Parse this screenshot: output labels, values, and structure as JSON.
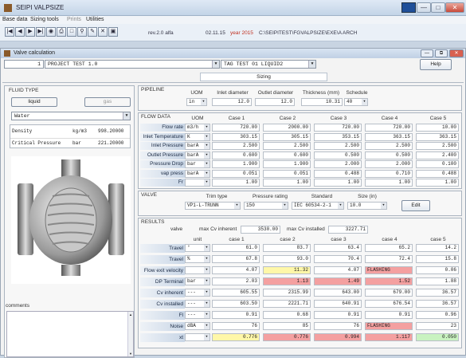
{
  "app": {
    "title": "SEIPI VALPSIZE"
  },
  "menu": [
    "Base data",
    "Sizing tools",
    "Prints",
    "Utilities"
  ],
  "toolbar": {
    "version": "rev.2.0 alfa",
    "time": "02.11.15",
    "year": "year 2015",
    "path": "C:\\SEIPITEST\\FGVALPSIZE\\EXE\\A  ARCH"
  },
  "window": {
    "title": "Valve calculation"
  },
  "header": {
    "project_no": "1",
    "project": "PROJECT TEST 1.0",
    "tag": "TAG TEST 01 LIQUID2",
    "help": "Help",
    "tab": "Sizing"
  },
  "fluid": {
    "section": "FLUID TYPE",
    "liquid": "liquid",
    "gas": "gas",
    "selected": "Water",
    "props": [
      {
        "name": "Density",
        "unit": "kg/m3",
        "value": "998.20000"
      },
      {
        "name": "Critical Pressure",
        "unit": "bar",
        "value": "221.20000"
      }
    ]
  },
  "comments_label": "comments",
  "pipeline": {
    "section": "PIPELINE",
    "headers": [
      "UOM",
      "Inlet diameter",
      "Outlet diameter",
      "Thickness (mm)",
      "Schedule"
    ],
    "uom": "in",
    "inlet": "12.0",
    "outlet": "12.0",
    "thickness": "10.31",
    "schedule": "40"
  },
  "flow": {
    "section": "FLOW DATA",
    "headers": [
      "UOM",
      "Case 1",
      "Case 2",
      "Case 3",
      "Case 4",
      "Case 5"
    ],
    "rows": [
      {
        "label": "Flow rate",
        "unit": "m3/h",
        "values": [
          "720.00",
          "2000.00",
          "720.00",
          "720.00",
          "10.00"
        ]
      },
      {
        "label": "Inlet Temperature",
        "unit": "K",
        "values": [
          "303.15",
          "305.15",
          "353.15",
          "363.15",
          "363.15"
        ]
      },
      {
        "label": "Inlet Pressure",
        "unit": "barA",
        "values": [
          "2.500",
          "2.500",
          "2.500",
          "2.500",
          "2.500"
        ]
      },
      {
        "label": "Outlet Pressure",
        "unit": "barA",
        "values": [
          "0.600",
          "0.600",
          "0.500",
          "0.500",
          "2.400"
        ]
      },
      {
        "label": "Pressure Drop",
        "unit": "bar",
        "values": [
          "1.900",
          "1.900",
          "2.000",
          "2.000",
          "0.100"
        ]
      },
      {
        "label": "vap press",
        "unit": "barA",
        "values": [
          "0.051",
          "0.051",
          "0.488",
          "0.710",
          "0.488"
        ]
      },
      {
        "label": "Fr",
        "unit": "",
        "values": [
          "1.00",
          "1.00",
          "1.00",
          "1.00",
          "1.00"
        ]
      }
    ]
  },
  "valve": {
    "section": "VALVE",
    "headers": [
      "Trim type",
      "Pressure rating",
      "Standard",
      "Size (in)"
    ],
    "trim": "VP1-L-TRUNN",
    "rating": "150",
    "standard": "IEC 60534-2-1",
    "size": "10.0",
    "edit": "Edit"
  },
  "results": {
    "section": "RESULTS",
    "valve_label": "valve",
    "cv_inherent_label": "max Cv inherent",
    "cv_inherent": "3530.00",
    "cv_installed_label": "max Cv installed",
    "cv_installed": "3227.71",
    "headers": [
      "unit",
      "case 1",
      "case 2",
      "case 3",
      "case 4",
      "case 5"
    ],
    "rows": [
      {
        "label": "Travel",
        "unit": "°",
        "values": [
          "61.0",
          "83.7",
          "63.4",
          "65.2",
          "14.2"
        ],
        "colors": [
          "",
          "",
          "",
          "",
          ""
        ]
      },
      {
        "label": "Travel",
        "unit": "%",
        "values": [
          "67.8",
          "93.0",
          "70.4",
          "72.4",
          "15.8"
        ],
        "colors": [
          "",
          "",
          "",
          "",
          ""
        ]
      },
      {
        "label": "Flow exit velocity",
        "unit": "",
        "values": [
          "4.07",
          "11.32",
          "4.07",
          "FLASHING",
          "0.06"
        ],
        "colors": [
          "",
          "#fff7a8",
          "",
          "#f4a0a0",
          ""
        ]
      },
      {
        "label": "DP Terminal",
        "unit": "bar",
        "values": [
          "2.03",
          "1.13",
          "1.49",
          "1.52",
          "1.88"
        ],
        "colors": [
          "",
          "#f4a0a0",
          "#f4a0a0",
          "#f4a0a0",
          ""
        ]
      },
      {
        "label": "Cv inherent",
        "unit": "---",
        "values": [
          "605.55",
          "2315.99",
          "643.00",
          "679.00",
          "36.57"
        ],
        "colors": [
          "",
          "",
          "",
          "",
          ""
        ]
      },
      {
        "label": "Cv installed",
        "unit": "---",
        "values": [
          "603.50",
          "2221.71",
          "640.91",
          "676.54",
          "36.57"
        ],
        "colors": [
          "",
          "",
          "",
          "",
          ""
        ]
      },
      {
        "label": "Fl",
        "unit": "---",
        "values": [
          "0.91",
          "0.68",
          "0.91",
          "0.91",
          "0.96"
        ],
        "colors": [
          "",
          "",
          "",
          "",
          ""
        ]
      },
      {
        "label": "Noise",
        "unit": "dBA",
        "values": [
          "76",
          "85",
          "76",
          "FLASHING",
          "23"
        ],
        "colors": [
          "",
          "",
          "",
          "#f4a0a0",
          ""
        ]
      },
      {
        "label": "xt",
        "unit": "",
        "values": [
          "0.776",
          "0.776",
          "0.994",
          "1.117",
          "0.050"
        ],
        "colors": [
          "#fff7a8",
          "#f4a0a0",
          "#f4a0a0",
          "#f4a0a0",
          "#c9f2c0"
        ]
      }
    ]
  }
}
